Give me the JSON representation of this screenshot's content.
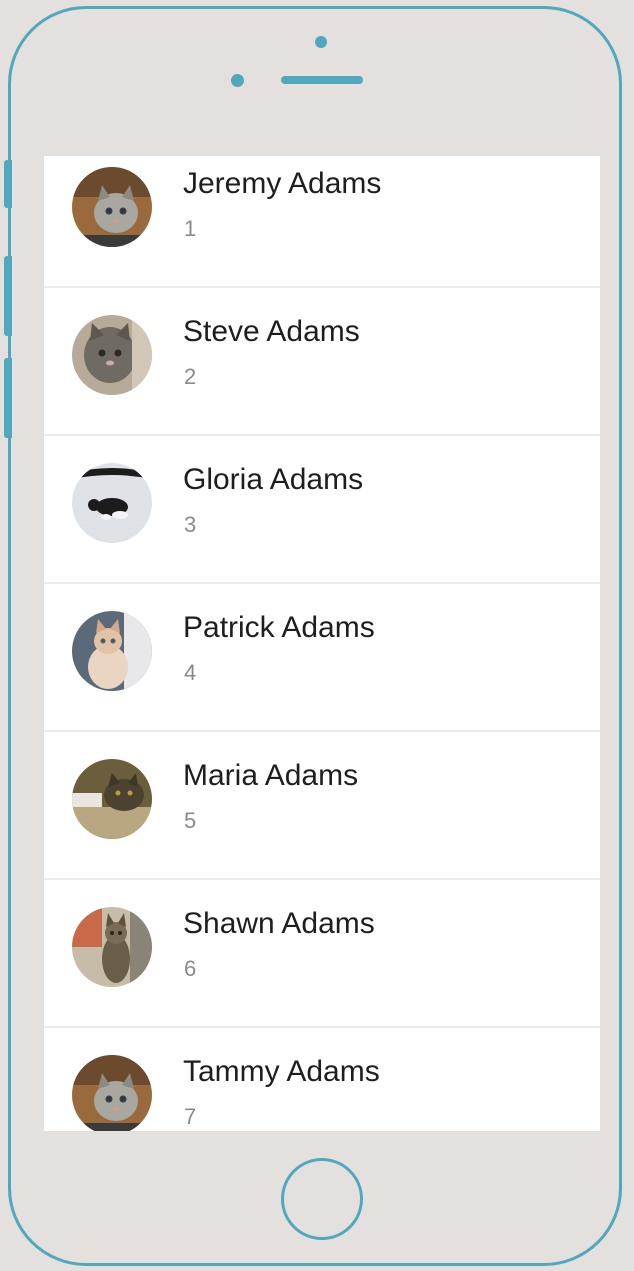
{
  "contacts": [
    {
      "name": "Jeremy Adams",
      "number": "1",
      "avatar_icon": "cat-photo-icon"
    },
    {
      "name": "Steve Adams",
      "number": "2",
      "avatar_icon": "cat-photo-icon"
    },
    {
      "name": "Gloria Adams",
      "number": "3",
      "avatar_icon": "cat-photo-icon"
    },
    {
      "name": "Patrick Adams",
      "number": "4",
      "avatar_icon": "cat-photo-icon"
    },
    {
      "name": "Maria Adams",
      "number": "5",
      "avatar_icon": "cat-photo-icon"
    },
    {
      "name": "Shawn Adams",
      "number": "6",
      "avatar_icon": "cat-photo-icon"
    },
    {
      "name": "Tammy Adams",
      "number": "7",
      "avatar_icon": "cat-photo-icon"
    }
  ],
  "colors": {
    "frame": "#4fa8bd",
    "background": "#e3e0dd",
    "screen": "#ffffff"
  }
}
